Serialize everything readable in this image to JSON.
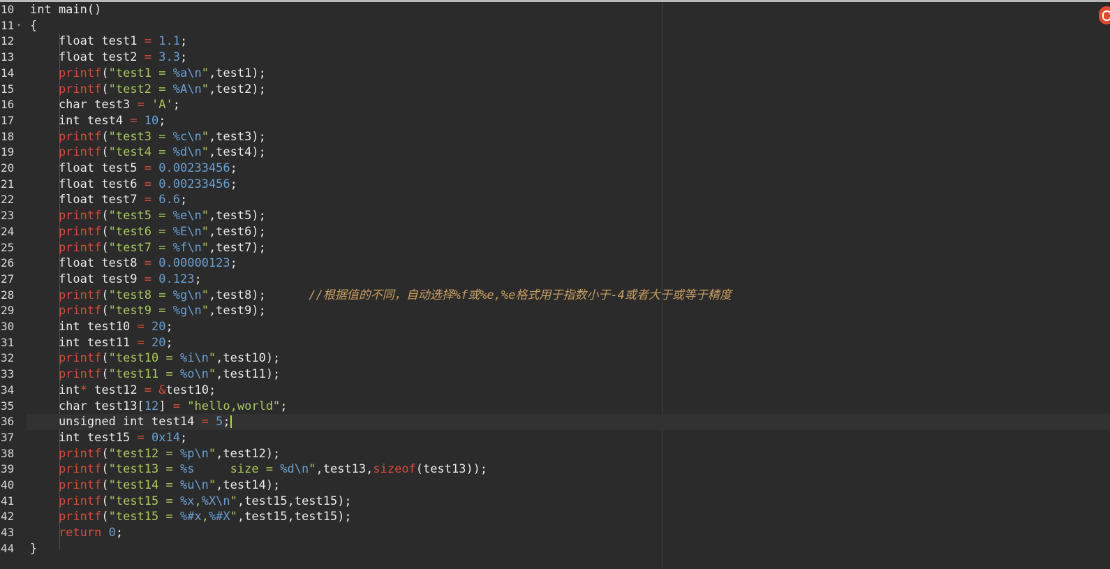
{
  "editor": {
    "current_line": 36,
    "comment_color": "#c89d62",
    "lines": [
      {
        "num": "10",
        "tokens": [
          [
            "kw",
            "int main()"
          ]
        ]
      },
      {
        "num": "11",
        "fold": true,
        "tokens": [
          [
            "kw",
            "{"
          ]
        ]
      },
      {
        "num": "12",
        "tokens": [
          [
            "kw",
            "    float test1 "
          ],
          [
            "op",
            "="
          ],
          [
            "kw",
            " "
          ],
          [
            "num",
            "1.1"
          ],
          [
            "kw",
            ";"
          ]
        ]
      },
      {
        "num": "13",
        "tokens": [
          [
            "kw",
            "    float test2 "
          ],
          [
            "op",
            "="
          ],
          [
            "kw",
            " "
          ],
          [
            "num",
            "3.3"
          ],
          [
            "kw",
            ";"
          ]
        ]
      },
      {
        "num": "14",
        "tokens": [
          [
            "fn",
            "    printf"
          ],
          [
            "kw",
            "("
          ],
          [
            "str",
            "\"test1 = "
          ],
          [
            "esc",
            "%a\\n"
          ],
          [
            "str",
            "\""
          ],
          [
            "kw",
            ",test1);"
          ]
        ]
      },
      {
        "num": "15",
        "tokens": [
          [
            "fn",
            "    printf"
          ],
          [
            "kw",
            "("
          ],
          [
            "str",
            "\"test2 = "
          ],
          [
            "esc",
            "%A\\n"
          ],
          [
            "str",
            "\""
          ],
          [
            "kw",
            ",test2);"
          ]
        ]
      },
      {
        "num": "16",
        "tokens": [
          [
            "kw",
            "    char test3 "
          ],
          [
            "op",
            "="
          ],
          [
            "kw",
            " "
          ],
          [
            "str",
            "'A'"
          ],
          [
            "kw",
            ";"
          ]
        ]
      },
      {
        "num": "17",
        "tokens": [
          [
            "kw",
            "    int test4 "
          ],
          [
            "op",
            "="
          ],
          [
            "kw",
            " "
          ],
          [
            "num",
            "10"
          ],
          [
            "kw",
            ";"
          ]
        ]
      },
      {
        "num": "18",
        "tokens": [
          [
            "fn",
            "    printf"
          ],
          [
            "kw",
            "("
          ],
          [
            "str",
            "\"test3 = "
          ],
          [
            "esc",
            "%c\\n"
          ],
          [
            "str",
            "\""
          ],
          [
            "kw",
            ",test3);"
          ]
        ]
      },
      {
        "num": "19",
        "tokens": [
          [
            "fn",
            "    printf"
          ],
          [
            "kw",
            "("
          ],
          [
            "str",
            "\"test4 = "
          ],
          [
            "esc",
            "%d\\n"
          ],
          [
            "str",
            "\""
          ],
          [
            "kw",
            ",test4);"
          ]
        ]
      },
      {
        "num": "20",
        "tokens": [
          [
            "kw",
            "    float test5 "
          ],
          [
            "op",
            "="
          ],
          [
            "kw",
            " "
          ],
          [
            "num",
            "0.00233456"
          ],
          [
            "kw",
            ";"
          ]
        ]
      },
      {
        "num": "21",
        "tokens": [
          [
            "kw",
            "    float test6 "
          ],
          [
            "op",
            "="
          ],
          [
            "kw",
            " "
          ],
          [
            "num",
            "0.00233456"
          ],
          [
            "kw",
            ";"
          ]
        ]
      },
      {
        "num": "22",
        "tokens": [
          [
            "kw",
            "    float test7 "
          ],
          [
            "op",
            "="
          ],
          [
            "kw",
            " "
          ],
          [
            "num",
            "6.6"
          ],
          [
            "kw",
            ";"
          ]
        ]
      },
      {
        "num": "23",
        "tokens": [
          [
            "fn",
            "    printf"
          ],
          [
            "kw",
            "("
          ],
          [
            "str",
            "\"test5 = "
          ],
          [
            "esc",
            "%e\\n"
          ],
          [
            "str",
            "\""
          ],
          [
            "kw",
            ",test5);"
          ]
        ]
      },
      {
        "num": "24",
        "tokens": [
          [
            "fn",
            "    printf"
          ],
          [
            "kw",
            "("
          ],
          [
            "str",
            "\"test6 = "
          ],
          [
            "esc",
            "%E\\n"
          ],
          [
            "str",
            "\""
          ],
          [
            "kw",
            ",test6);"
          ]
        ]
      },
      {
        "num": "25",
        "tokens": [
          [
            "fn",
            "    printf"
          ],
          [
            "kw",
            "("
          ],
          [
            "str",
            "\"test7 = "
          ],
          [
            "esc",
            "%f\\n"
          ],
          [
            "str",
            "\""
          ],
          [
            "kw",
            ",test7);"
          ]
        ]
      },
      {
        "num": "26",
        "tokens": [
          [
            "kw",
            "    float test8 "
          ],
          [
            "op",
            "="
          ],
          [
            "kw",
            " "
          ],
          [
            "num",
            "0.00000123"
          ],
          [
            "kw",
            ";"
          ]
        ]
      },
      {
        "num": "27",
        "tokens": [
          [
            "kw",
            "    float test9 "
          ],
          [
            "op",
            "="
          ],
          [
            "kw",
            " "
          ],
          [
            "num",
            "0.123"
          ],
          [
            "kw",
            ";"
          ]
        ]
      },
      {
        "num": "28",
        "tokens": [
          [
            "fn",
            "    printf"
          ],
          [
            "kw",
            "("
          ],
          [
            "str",
            "\"test8 = "
          ],
          [
            "esc",
            "%g\\n"
          ],
          [
            "str",
            "\""
          ],
          [
            "kw",
            ",test8);      "
          ],
          [
            "cmt",
            "//根据值的不同，自动选择%f或%e,%e格式用于指数小于-4或者大于或等于精度"
          ]
        ]
      },
      {
        "num": "29",
        "tokens": [
          [
            "fn",
            "    printf"
          ],
          [
            "kw",
            "("
          ],
          [
            "str",
            "\"test9 = "
          ],
          [
            "esc",
            "%g\\n"
          ],
          [
            "str",
            "\""
          ],
          [
            "kw",
            ",test9);"
          ]
        ]
      },
      {
        "num": "30",
        "tokens": [
          [
            "kw",
            "    int test10 "
          ],
          [
            "op",
            "="
          ],
          [
            "kw",
            " "
          ],
          [
            "num",
            "20"
          ],
          [
            "kw",
            ";"
          ]
        ]
      },
      {
        "num": "31",
        "tokens": [
          [
            "kw",
            "    int test11 "
          ],
          [
            "op",
            "="
          ],
          [
            "kw",
            " "
          ],
          [
            "num",
            "20"
          ],
          [
            "kw",
            ";"
          ]
        ]
      },
      {
        "num": "32",
        "tokens": [
          [
            "fn",
            "    printf"
          ],
          [
            "kw",
            "("
          ],
          [
            "str",
            "\"test10 = "
          ],
          [
            "esc",
            "%i\\n"
          ],
          [
            "str",
            "\""
          ],
          [
            "kw",
            ",test10);"
          ]
        ]
      },
      {
        "num": "33",
        "tokens": [
          [
            "fn",
            "    printf"
          ],
          [
            "kw",
            "("
          ],
          [
            "str",
            "\"test11 = "
          ],
          [
            "esc",
            "%o\\n"
          ],
          [
            "str",
            "\""
          ],
          [
            "kw",
            ",test11);"
          ]
        ]
      },
      {
        "num": "34",
        "tokens": [
          [
            "kw",
            "    int"
          ],
          [
            "op",
            "*"
          ],
          [
            "kw",
            " test12 "
          ],
          [
            "op",
            "="
          ],
          [
            "kw",
            " "
          ],
          [
            "op",
            "&"
          ],
          [
            "kw",
            "test10;"
          ]
        ]
      },
      {
        "num": "35",
        "tokens": [
          [
            "kw",
            "    char test13["
          ],
          [
            "num",
            "12"
          ],
          [
            "kw",
            "] "
          ],
          [
            "op",
            "="
          ],
          [
            "kw",
            " "
          ],
          [
            "str",
            "\"hello,world\""
          ],
          [
            "kw",
            ";"
          ]
        ]
      },
      {
        "num": "36",
        "tokens": [
          [
            "kw",
            "    unsigned int test14 "
          ],
          [
            "op",
            "="
          ],
          [
            "kw",
            " "
          ],
          [
            "num",
            "5"
          ],
          [
            "kw",
            ";"
          ]
        ]
      },
      {
        "num": "37",
        "tokens": [
          [
            "kw",
            "    int test15 "
          ],
          [
            "op",
            "="
          ],
          [
            "kw",
            " "
          ],
          [
            "num",
            "0x14"
          ],
          [
            "kw",
            ";"
          ]
        ]
      },
      {
        "num": "38",
        "tokens": [
          [
            "fn",
            "    printf"
          ],
          [
            "kw",
            "("
          ],
          [
            "str",
            "\"test12 = "
          ],
          [
            "esc",
            "%p\\n"
          ],
          [
            "str",
            "\""
          ],
          [
            "kw",
            ",test12);"
          ]
        ]
      },
      {
        "num": "39",
        "tokens": [
          [
            "fn",
            "    printf"
          ],
          [
            "kw",
            "("
          ],
          [
            "str",
            "\"test13 = "
          ],
          [
            "esc",
            "%s"
          ],
          [
            "str",
            "     size = "
          ],
          [
            "esc",
            "%d\\n"
          ],
          [
            "str",
            "\""
          ],
          [
            "kw",
            ",test13,"
          ],
          [
            "fn",
            "sizeof"
          ],
          [
            "kw",
            "(test13));"
          ]
        ]
      },
      {
        "num": "40",
        "tokens": [
          [
            "fn",
            "    printf"
          ],
          [
            "kw",
            "("
          ],
          [
            "str",
            "\"test14 = "
          ],
          [
            "esc",
            "%u\\n"
          ],
          [
            "str",
            "\""
          ],
          [
            "kw",
            ",test14);"
          ]
        ]
      },
      {
        "num": "41",
        "tokens": [
          [
            "fn",
            "    printf"
          ],
          [
            "kw",
            "("
          ],
          [
            "str",
            "\"test15 = "
          ],
          [
            "esc",
            "%x"
          ],
          [
            "str",
            ","
          ],
          [
            "esc",
            "%X\\n"
          ],
          [
            "str",
            "\""
          ],
          [
            "kw",
            ",test15,test15);"
          ]
        ]
      },
      {
        "num": "42",
        "tokens": [
          [
            "fn",
            "    printf"
          ],
          [
            "kw",
            "("
          ],
          [
            "str",
            "\"test15 = "
          ],
          [
            "esc",
            "%#x"
          ],
          [
            "str",
            ","
          ],
          [
            "esc",
            "%#X"
          ],
          [
            "str",
            "\""
          ],
          [
            "kw",
            ",test15,test15);"
          ]
        ]
      },
      {
        "num": "43",
        "tokens": [
          [
            "fn",
            "    return"
          ],
          [
            "kw",
            " "
          ],
          [
            "num",
            "0"
          ],
          [
            "kw",
            ";"
          ]
        ]
      },
      {
        "num": "44",
        "tokens": [
          [
            "kw",
            "}"
          ]
        ]
      }
    ]
  },
  "icons": {
    "corner": "notification-badge-icon"
  }
}
